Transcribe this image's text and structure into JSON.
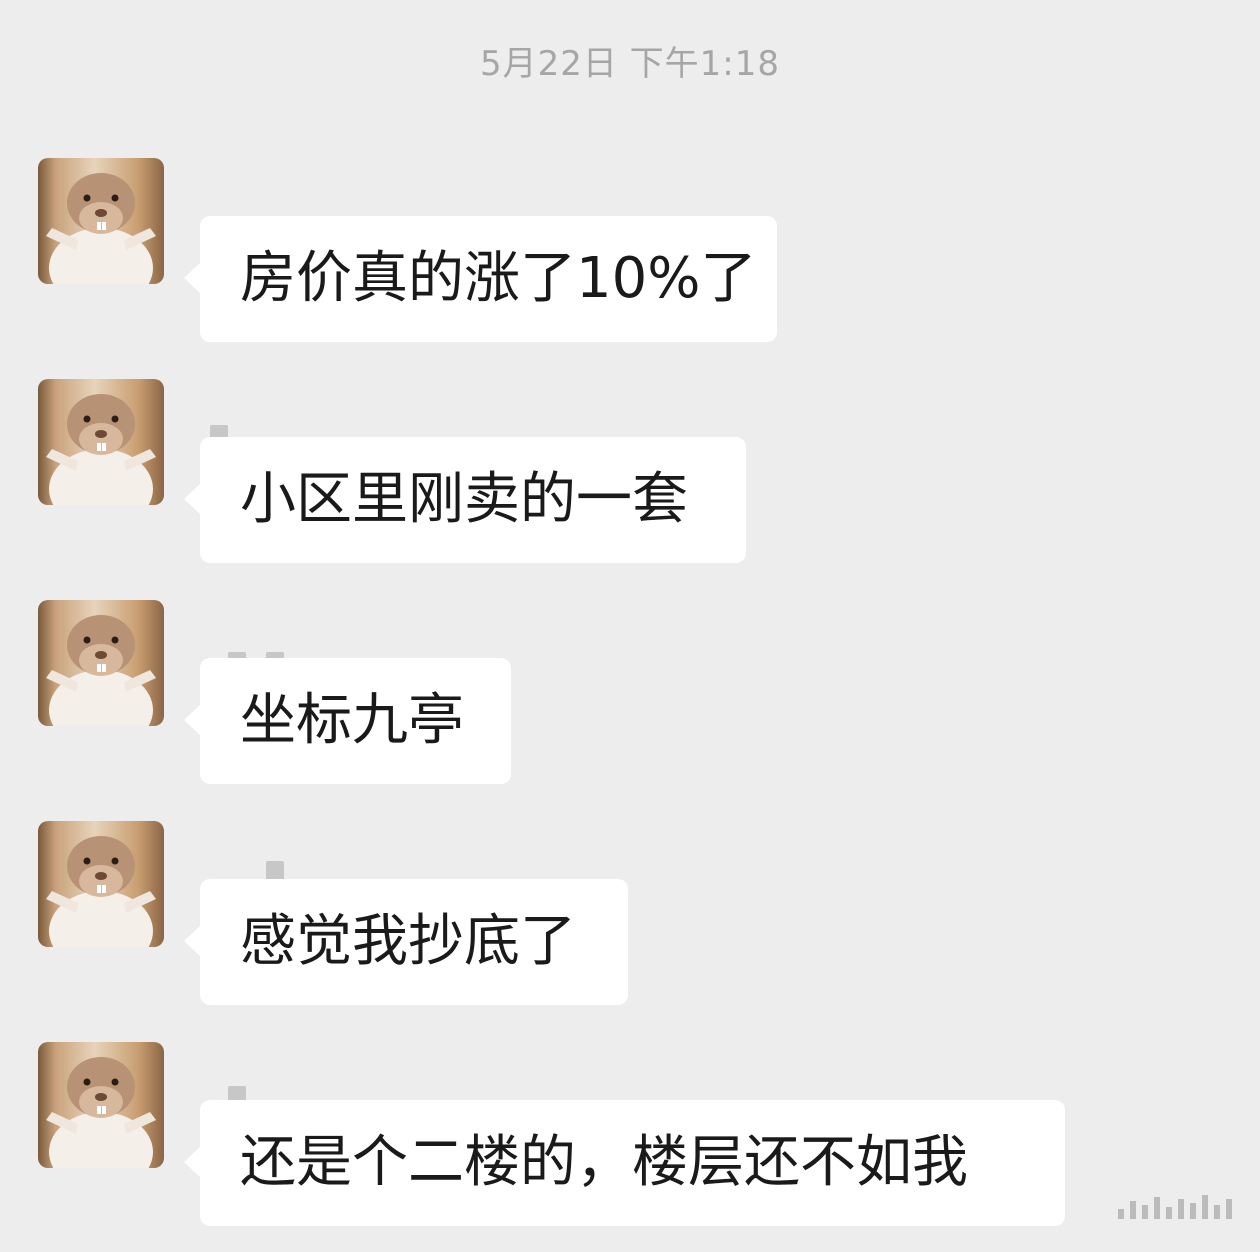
{
  "chat": {
    "timestamp": "5月22日  下午1:18",
    "messages": [
      {
        "text": "房价真的涨了10%了"
      },
      {
        "text": "小区里刚卖的一套"
      },
      {
        "text": "坐标九亭"
      },
      {
        "text": "感觉我抄底了"
      },
      {
        "text": "还是个二楼的，楼层还不如我"
      }
    ]
  },
  "colors": {
    "background": "#ededed",
    "bubble": "#ffffff",
    "text": "#1a1a1a",
    "timestamp": "#a6a6a6"
  }
}
